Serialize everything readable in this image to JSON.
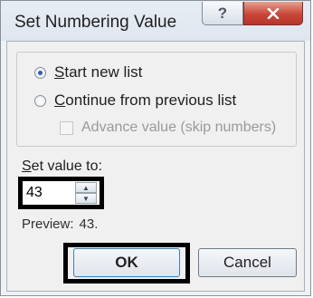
{
  "dialog": {
    "title": "Set Numbering Value",
    "help_label": "?",
    "close_label": "x"
  },
  "options": {
    "start_new": {
      "label": "Start new list",
      "selected": true
    },
    "continue_previous": {
      "label": "Continue from previous list",
      "selected": false
    },
    "advance_value": {
      "label": "Advance value (skip numbers)",
      "checked": false,
      "enabled": false
    }
  },
  "set_value": {
    "label": "Set value to:",
    "value": "43"
  },
  "preview": {
    "label": "Preview:",
    "value": "43."
  },
  "buttons": {
    "ok": "OK",
    "cancel": "Cancel"
  },
  "colors": {
    "close_button": "#c9473a",
    "radio_dot": "#2c5fb3",
    "highlight_outline": "#000000"
  }
}
